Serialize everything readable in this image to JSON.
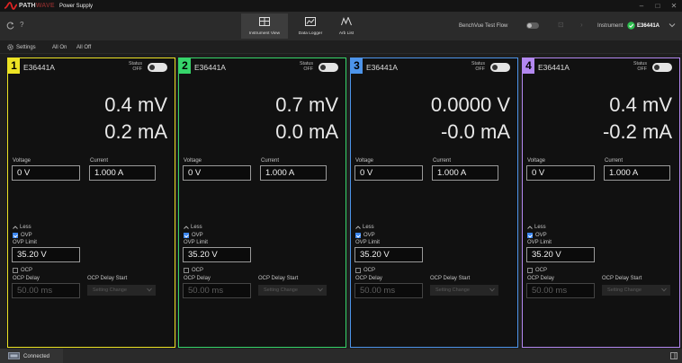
{
  "app": {
    "brand_path": "PATH",
    "brand_wave": "WAVE",
    "title": "Power Supply",
    "logo_icon": "keysight-wave-icon",
    "accent": "#e02424"
  },
  "window": {
    "minimize": "–",
    "maximize": "□",
    "close": "✕"
  },
  "toolbar": {
    "refresh_icon": "refresh-icon",
    "help": "?",
    "views": [
      {
        "label": "Instrument View",
        "icon": "instrument-view-icon",
        "active": true
      },
      {
        "label": "Data Logger",
        "icon": "data-logger-icon",
        "active": false
      },
      {
        "label": "Arb List",
        "icon": "arb-list-icon",
        "active": false
      }
    ],
    "test_flow_label": "BenchVue Test Flow",
    "test_flow_on": false,
    "instrument_label": "Instrument",
    "instrument_model": "E36441A",
    "connection_color": "#2ebf4f"
  },
  "actions": {
    "settings": "Settings",
    "all_on": "All On",
    "all_off": "All Off"
  },
  "labels": {
    "status": "Status",
    "voltage": "Voltage",
    "current": "Current",
    "less": "Less",
    "ovp": "OVP",
    "ovp_limit": "OVP Limit",
    "ocp": "OCP",
    "ocp_delay": "OCP Delay",
    "ocp_delay_start": "OCP Delay Start"
  },
  "channels": [
    {
      "number": "1",
      "color": "#ece324",
      "model": "E36441A",
      "state": "OFF",
      "voltage_reading": "0.4 mV",
      "current_reading": "0.2 mA",
      "voltage_set": "0 V",
      "current_set": "1.000 A",
      "ovp_checked": true,
      "ovp_limit": "35.20 V",
      "ocp_checked": false,
      "ocp_delay": "50.00 ms",
      "ocp_delay_start": "Setting Change"
    },
    {
      "number": "2",
      "color": "#36d46a",
      "model": "E36441A",
      "state": "OFF",
      "voltage_reading": "0.7 mV",
      "current_reading": "0.0 mA",
      "voltage_set": "0 V",
      "current_set": "1.000 A",
      "ovp_checked": true,
      "ovp_limit": "35.20 V",
      "ocp_checked": false,
      "ocp_delay": "50.00 ms",
      "ocp_delay_start": "Setting Change"
    },
    {
      "number": "3",
      "color": "#4d94ea",
      "model": "E36441A",
      "state": "OFF",
      "voltage_reading": "0.0000  V",
      "current_reading": "-0.0 mA",
      "voltage_set": "0 V",
      "current_set": "1.000 A",
      "ovp_checked": true,
      "ovp_limit": "35.20 V",
      "ocp_checked": false,
      "ocp_delay": "50.00 ms",
      "ocp_delay_start": "Setting Change"
    },
    {
      "number": "4",
      "color": "#b388f0",
      "model": "E36441A",
      "state": "OFF",
      "voltage_reading": "0.4 mV",
      "current_reading": "-0.2 mA",
      "voltage_set": "0 V",
      "current_set": "1.000 A",
      "ovp_checked": true,
      "ovp_limit": "35.20 V",
      "ocp_checked": false,
      "ocp_delay": "50.00 ms",
      "ocp_delay_start": "Setting Change"
    }
  ],
  "status_bar": {
    "connection": "Connected",
    "connection_icon": "connection-icon",
    "right_icon": "panel-toggle-icon"
  }
}
